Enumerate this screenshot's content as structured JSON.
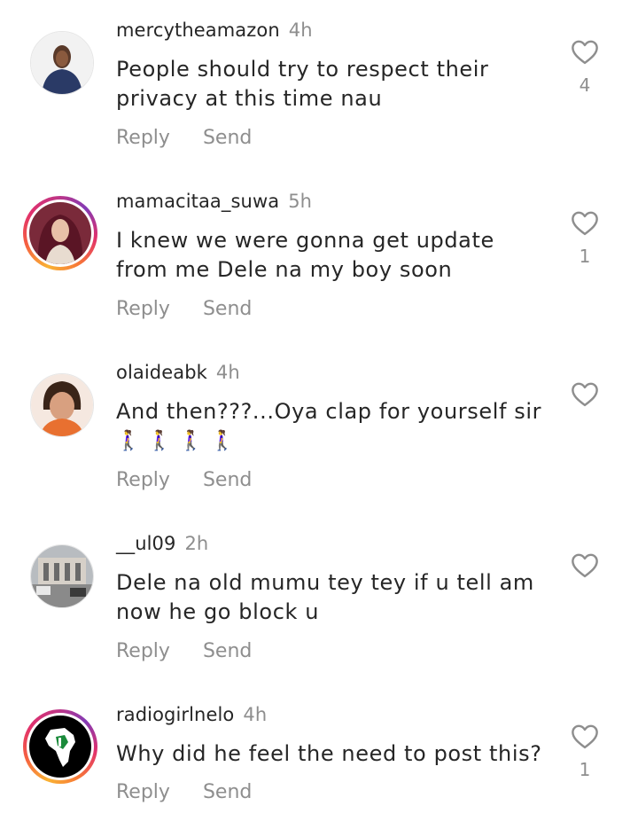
{
  "actions": {
    "reply": "Reply",
    "send": "Send"
  },
  "comments": [
    {
      "username": "mercytheamazon",
      "time": "4h",
      "text": "People should try to respect their privacy at this time nau",
      "likes": "4"
    },
    {
      "username": "mamacitaa_suwa",
      "time": "5h",
      "text": "I knew we were gonna get update from me Dele na my boy soon",
      "likes": "1"
    },
    {
      "username": "olaideabk",
      "time": "4h",
      "text": "And then???...Oya clap for yourself sir",
      "emoji": "🚶‍♀️🚶‍♀️🚶‍♀️🚶‍♀️",
      "likes": ""
    },
    {
      "username": "__ul09",
      "time": "2h",
      "text": "Dele na old mumu tey tey if u tell am now he go block u",
      "likes": ""
    },
    {
      "username": "radiogirlnelo",
      "time": "4h",
      "text": "Why did he feel the need to post this?",
      "likes": "1"
    }
  ]
}
